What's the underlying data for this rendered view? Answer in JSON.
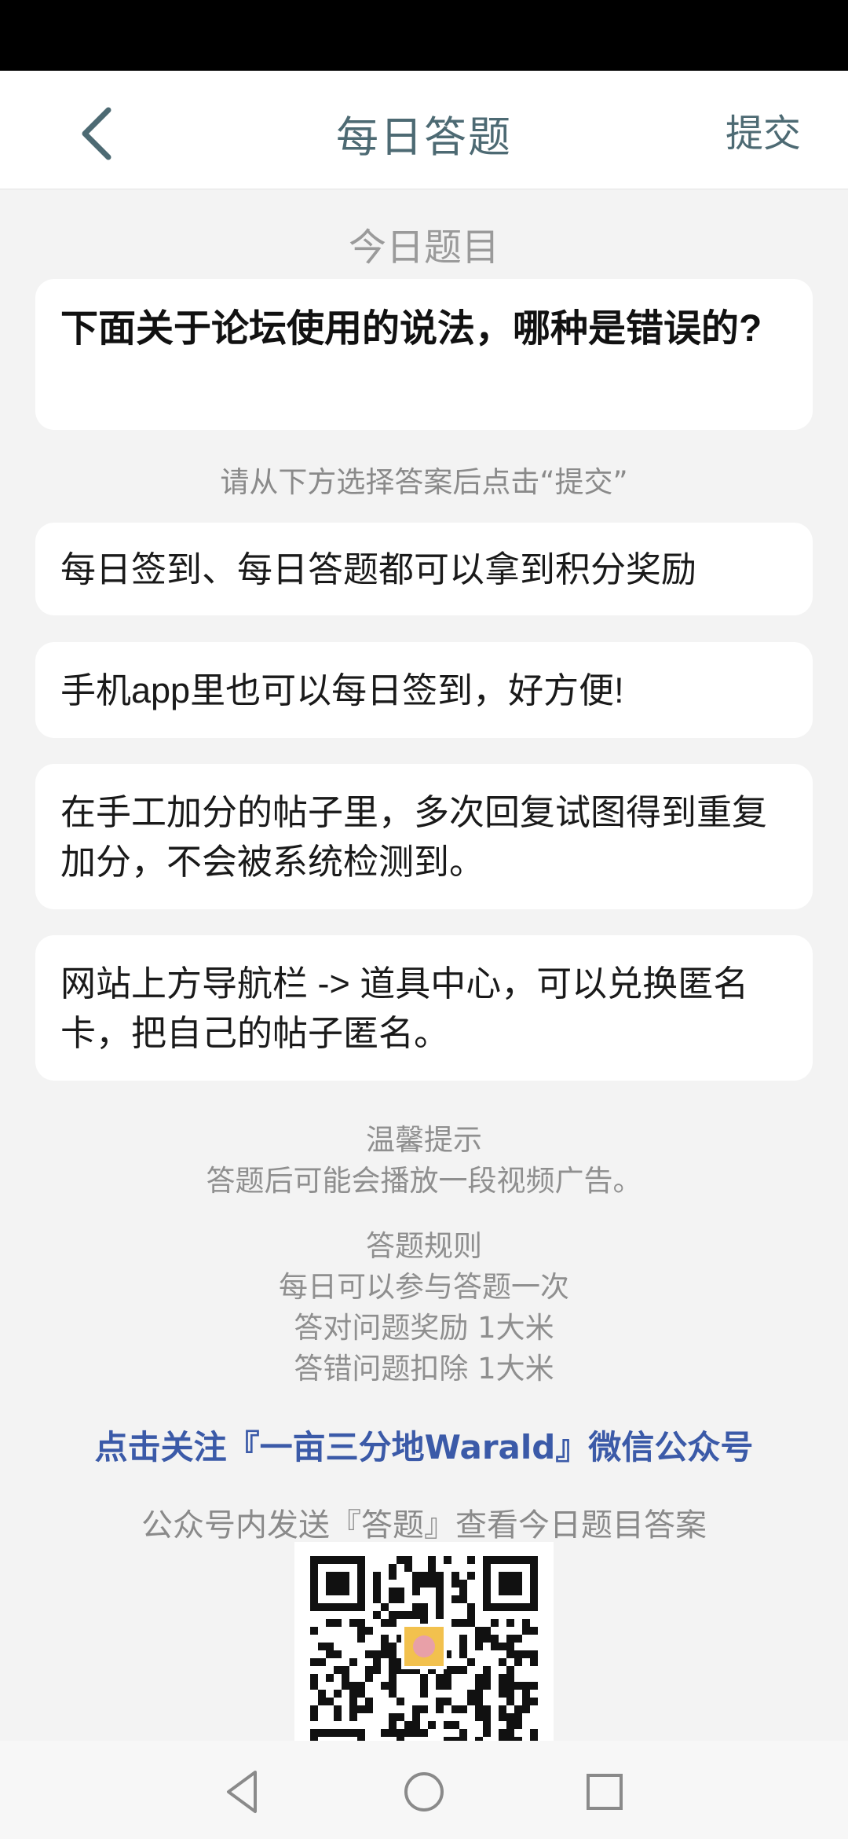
{
  "header": {
    "title": "每日答题",
    "submit_label": "提交"
  },
  "question": {
    "section_label": "今日题目",
    "text": "下面关于论坛使用的说法，哪种是错误的?",
    "hint": "请从下方选择答案后点击“提交”"
  },
  "options": [
    "每日签到、每日答题都可以拿到积分奖励",
    "手机app里也可以每日签到，好方便!",
    "在手工加分的帖子里，多次回复试图得到重复加分，不会被系统检测到。",
    "网站上方导航栏 -> 道具中心，可以兑换匿名卡，把自己的帖子匿名。"
  ],
  "tips": {
    "title": "温馨提示",
    "line": "答题后可能会播放一段视频广告。"
  },
  "rules": {
    "title": "答题规则",
    "lines": [
      "每日可以参与答题一次",
      "答对问题奖励 1大米",
      "答错问题扣除 1大米"
    ]
  },
  "follow": {
    "link_text": "点击关注『一亩三分地Warald』微信公众号",
    "send_hint": "公众号内发送『答题』查看今日题目答案"
  },
  "icons": {
    "back": "chevron-left-icon",
    "nav_back": "triangle-back-icon",
    "nav_home": "circle-home-icon",
    "nav_recent": "square-recent-icon"
  },
  "colors": {
    "accent": "#4d6a73",
    "link": "#3b5aa8",
    "background": "#f3f3f3"
  }
}
